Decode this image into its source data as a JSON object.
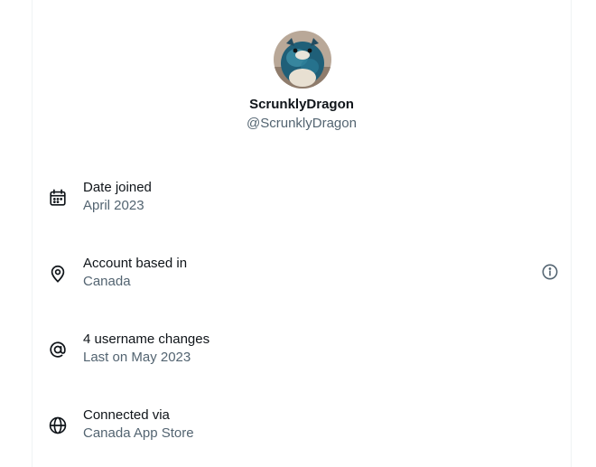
{
  "profile": {
    "display_name": "ScrunklyDragon",
    "handle": "@ScrunklyDragon"
  },
  "details": [
    {
      "icon": "calendar-icon",
      "title": "Date joined",
      "value": "April 2023"
    },
    {
      "icon": "location-pin-icon",
      "title": "Account based in",
      "value": "Canada",
      "action_icon": "info-icon"
    },
    {
      "icon": "at-sign-icon",
      "title": "4 username changes",
      "value": "Last on May 2023"
    },
    {
      "icon": "globe-icon",
      "title": "Connected via",
      "value": "Canada App Store"
    }
  ],
  "colors": {
    "primary_text": "#0f1419",
    "secondary_text": "#536471",
    "border": "#eff3f4"
  }
}
